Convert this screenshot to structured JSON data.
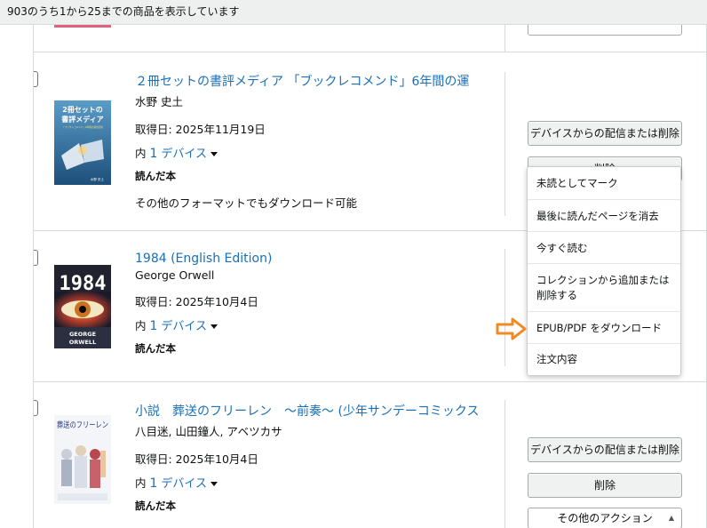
{
  "header": {
    "result_text": "903のうち1から25までの商品を表示しています"
  },
  "items": [
    {
      "title": "２冊セットの書評メディア 「ブックレコメンド」6年間の運",
      "author": "水野 史土",
      "acquired": "取得日: 2025年11月19日",
      "device_prefix": "内",
      "device_count": "1",
      "device_label": "デバイス",
      "status": "読んだ本",
      "extra": "その他のフォーマットでもダウンロード可能",
      "cover": {
        "line1": "2冊セットの",
        "line2": "書評メディア",
        "small": "「ブックレコメンド」6年間の運営記録",
        "author": "水野 史土"
      }
    },
    {
      "title": "1984 (English Edition)",
      "author": "George Orwell",
      "acquired": "取得日: 2025年10月4日",
      "device_prefix": "内",
      "device_count": "1",
      "device_label": "デバイス",
      "status": "読んだ本",
      "cover": {
        "title": "1984",
        "author1": "GEORGE",
        "author2": "ORWELL"
      }
    },
    {
      "title": "小説　葬送のフリーレン　～前奏～ (少年サンデーコミックス",
      "author": "八目迷, 山田鐘人, アベツカサ",
      "acquired": "取得日: 2025年10月4日",
      "device_prefix": "内",
      "device_count": "1",
      "device_label": "デバイス",
      "status": "読んだ本",
      "cover": {
        "title": "葬送のフリーレン"
      }
    }
  ],
  "buttons": {
    "deliver_or_delete": "デバイスからの配信または削除",
    "delete": "削除",
    "more_actions": "その他のアクション"
  },
  "dropdown": {
    "items": [
      "未読としてマーク",
      "最後に読んだページを消去",
      "今すぐ読む",
      "コレクションから追加または削除する",
      "EPUB/PDF をダウンロード",
      "注文内容"
    ]
  },
  "colors": {
    "link": "#1a6fb8",
    "arrow": "#f08a24",
    "button_bg": "#f0f2f2"
  }
}
